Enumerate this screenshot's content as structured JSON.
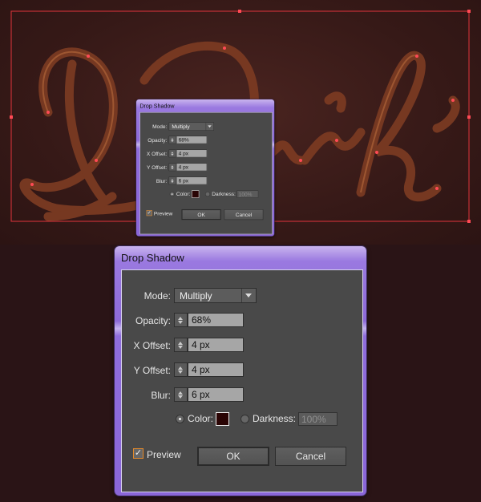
{
  "artwork": {
    "text": "Dark"
  },
  "dialog": {
    "title": "Drop Shadow",
    "mode_label": "Mode:",
    "mode_value": "Multiply",
    "opacity_label": "Opacity:",
    "opacity_value": "68%",
    "x_offset_label": "X Offset:",
    "x_offset_value": "4 px",
    "y_offset_label": "Y Offset:",
    "y_offset_value": "4 px",
    "blur_label": "Blur:",
    "blur_value": "6 px",
    "color_label": "Color:",
    "color_value": "#2a0505",
    "darkness_label": "Darkness:",
    "darkness_value": "100%",
    "preview_label": "Preview",
    "preview_checked": true,
    "ok_label": "OK",
    "cancel_label": "Cancel"
  }
}
